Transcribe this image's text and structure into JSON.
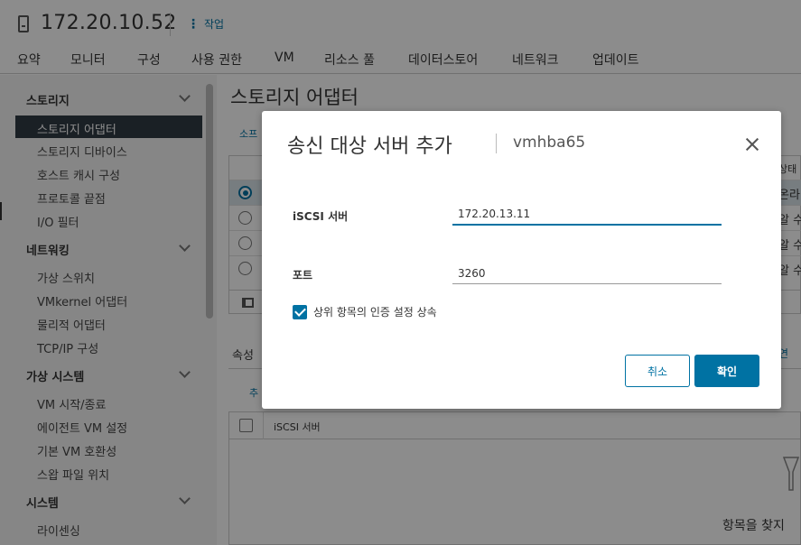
{
  "header": {
    "host_title": "172.20.10.52",
    "actions_label": "작업"
  },
  "tabs": [
    {
      "label": "요약"
    },
    {
      "label": "모니터"
    },
    {
      "label": "구성"
    },
    {
      "label": "사용 권한"
    },
    {
      "label": "VM"
    },
    {
      "label": "리소스 풀"
    },
    {
      "label": "데이터스토어"
    },
    {
      "label": "네트워크"
    },
    {
      "label": "업데이트"
    }
  ],
  "sidebar": {
    "groups": [
      {
        "label": "스토리지",
        "items": [
          "스토리지 어댑터",
          "스토리지 디바이스",
          "호스트 캐시 구성",
          "프로토콜 끝점",
          "I/O 필터"
        ]
      },
      {
        "label": "네트워킹",
        "items": [
          "가상 스위치",
          "VMkernel 어댑터",
          "물리적 어댑터",
          "TCP/IP 구성"
        ]
      },
      {
        "label": "가상 시스템",
        "items": [
          "VM 시작/종료",
          "에이전트 VM 설정",
          "기본 VM 호환성",
          "스왑 파일 위치"
        ]
      },
      {
        "label": "시스템",
        "items": [
          "라이센싱"
        ]
      }
    ]
  },
  "main": {
    "title": "스토리지 어댑터",
    "link_partial": "소프",
    "top_grid_header_partial": "상태",
    "top_grid_status": [
      "온라",
      "알 수",
      "알 수",
      "알 수"
    ],
    "lower_tab_partial": "속성",
    "lower_add_partial": "추",
    "right_link_partial": "연",
    "bottom_grid_col": "iSCSI 서버",
    "empty_text": "항목을 찾지"
  },
  "modal": {
    "title": "송신 대상 서버 추가",
    "subtitle": "vmhba65",
    "iscsi_label": "iSCSI 서버",
    "iscsi_value": "172.20.13.11",
    "port_label": "포트",
    "port_value": "3260",
    "inherit_label": "상위 항목의 인증 설정 상속",
    "inherit_checked": true,
    "cancel_label": "취소",
    "ok_label": "확인"
  },
  "colors": {
    "accent": "#0072a3",
    "sidebar_selected": "#313b44",
    "overlay": "rgba(0,0,0,0.45)"
  }
}
